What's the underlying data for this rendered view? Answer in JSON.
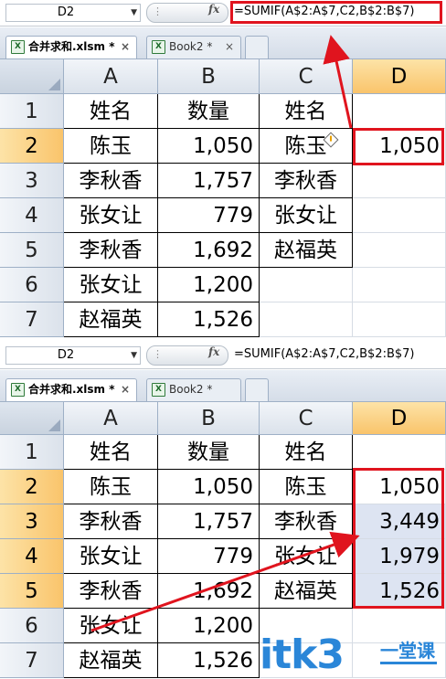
{
  "top": {
    "name_box": "D2",
    "formula": "=SUMIF(A$2:A$7,C2,B$2:B$7)",
    "tabs": [
      {
        "label": "合并求和.xlsm *",
        "close": "×"
      },
      {
        "label": "Book2 *",
        "close": "×"
      }
    ],
    "columns": [
      "A",
      "B",
      "C",
      "D"
    ],
    "rows": [
      {
        "num": "1",
        "a": "姓名",
        "b": "数量",
        "c": "姓名",
        "d": ""
      },
      {
        "num": "2",
        "a": "陈玉",
        "b": "1,050",
        "c": "陈玉",
        "d": "1,050"
      },
      {
        "num": "3",
        "a": "李秋香",
        "b": "1,757",
        "c": "李秋香",
        "d": ""
      },
      {
        "num": "4",
        "a": "张女让",
        "b": "779",
        "c": "张女让",
        "d": ""
      },
      {
        "num": "5",
        "a": "李秋香",
        "b": "1,692",
        "c": "赵福英",
        "d": ""
      },
      {
        "num": "6",
        "a": "张女让",
        "b": "1,200",
        "c": "",
        "d": ""
      },
      {
        "num": "7",
        "a": "赵福英",
        "b": "1,526",
        "c": "",
        "d": ""
      }
    ]
  },
  "bottom": {
    "name_box": "D2",
    "formula": "=SUMIF(A$2:A$7,C2,B$2:B$7)",
    "tabs": [
      {
        "label": "合并求和.xlsm *",
        "close": "×"
      },
      {
        "label": "Book2 *",
        "close": ""
      }
    ],
    "columns": [
      "A",
      "B",
      "C",
      "D"
    ],
    "rows": [
      {
        "num": "1",
        "a": "姓名",
        "b": "数量",
        "c": "姓名",
        "d": ""
      },
      {
        "num": "2",
        "a": "陈玉",
        "b": "1,050",
        "c": "陈玉",
        "d": "1,050"
      },
      {
        "num": "3",
        "a": "李秋香",
        "b": "1,757",
        "c": "李秋香",
        "d": "3,449"
      },
      {
        "num": "4",
        "a": "张女让",
        "b": "779",
        "c": "张女让",
        "d": "1,979"
      },
      {
        "num": "5",
        "a": "李秋香",
        "b": "1,692",
        "c": "赵福英",
        "d": "1,526"
      },
      {
        "num": "6",
        "a": "张女让",
        "b": "1,200",
        "c": "",
        "d": ""
      },
      {
        "num": "7",
        "a": "赵福英",
        "b": "1,526",
        "c": "",
        "d": ""
      }
    ]
  },
  "watermark": {
    "main": "itk3",
    "sub": "一堂课"
  },
  "colors": {
    "annotation_red": "#e0141e",
    "selected_header": "#f9c46b",
    "watermark_blue": "#2a86d8"
  },
  "icons": {
    "fx": "fx",
    "dropdown": "▼"
  }
}
